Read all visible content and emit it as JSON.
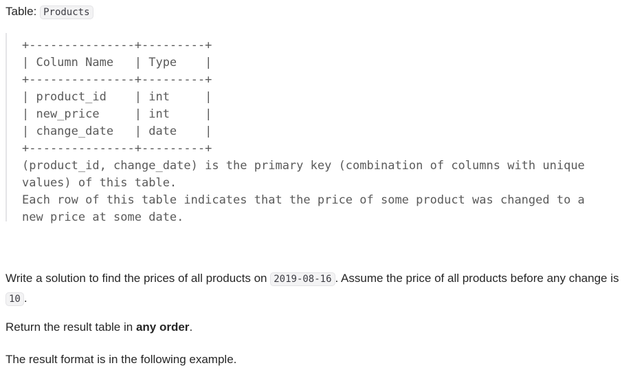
{
  "header": {
    "prefix": "Table: ",
    "table_name": "Products"
  },
  "schema_block": {
    "lines": [
      "+---------------+---------+",
      "| Column Name   | Type    |",
      "+---------------+---------+",
      "| product_id    | int     |",
      "| new_price     | int     |",
      "| change_date   | date    |",
      "+---------------+---------+",
      "(product_id, change_date) is the primary key (combination of columns with unique",
      "values) of this table.",
      "Each row of this table indicates that the price of some product was changed to a",
      "new price at some date."
    ]
  },
  "paragraph1": {
    "text_a": "Write a solution to find the prices of all products on ",
    "date": "2019-08-16",
    "text_b": ". Assume the price of all products before any change is ",
    "default_price": "10",
    "text_c": "."
  },
  "paragraph2": {
    "text_a": "Return the result table in ",
    "bold": "any order",
    "text_b": "."
  },
  "paragraph3": {
    "text": "The result format is in the following example."
  }
}
